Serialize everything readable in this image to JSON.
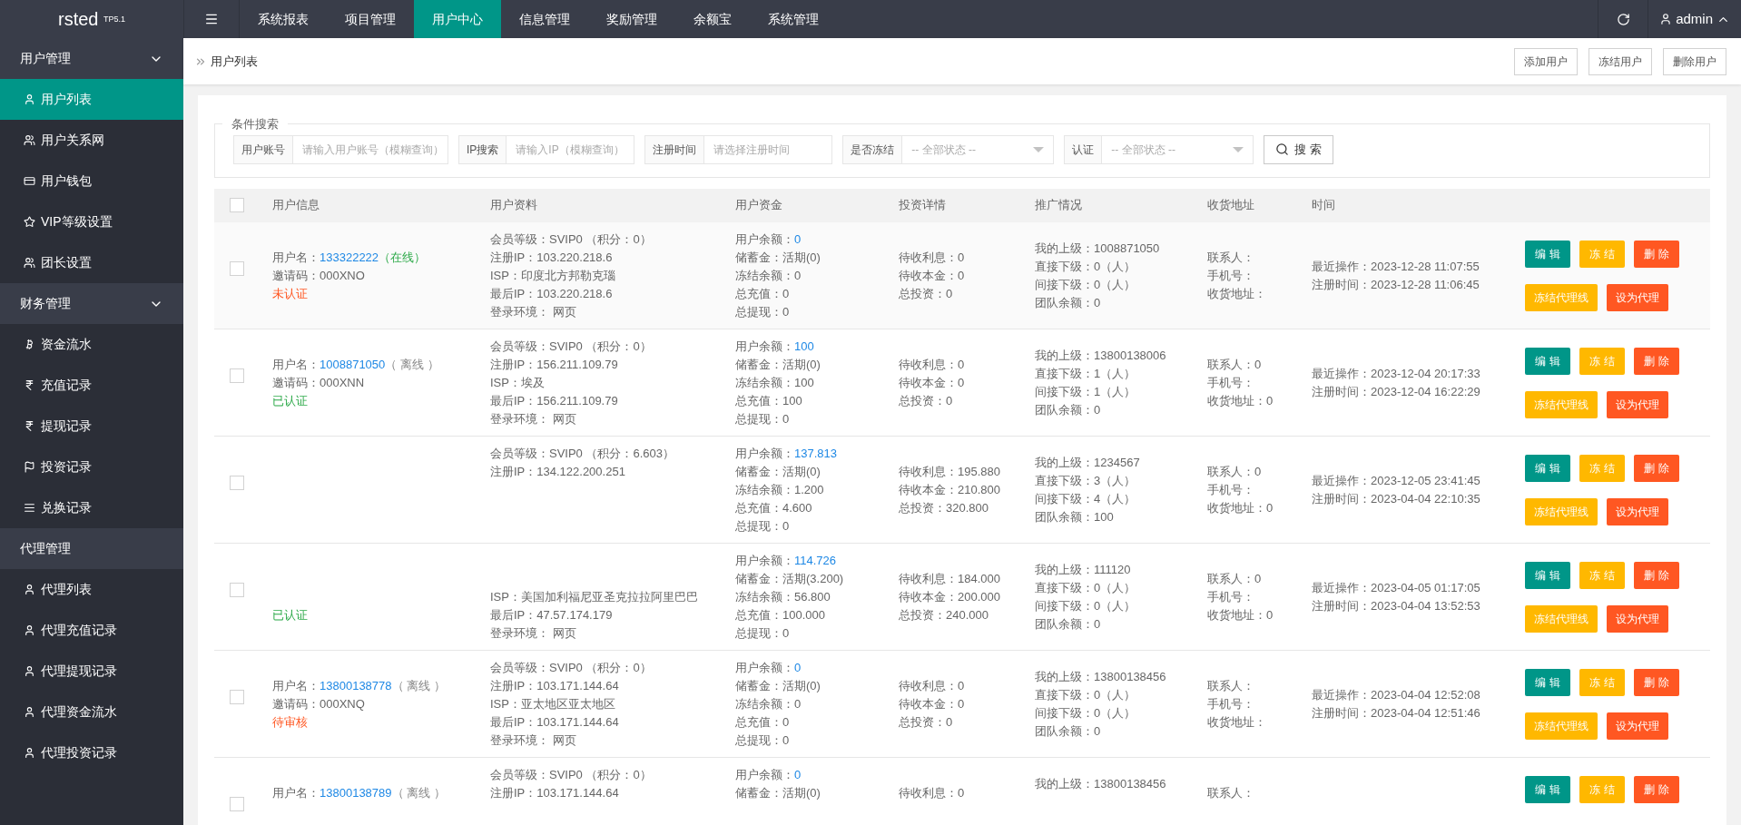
{
  "logo": "rsted $^{TP5.1}$",
  "nav": {
    "tabs": [
      {
        "label": "系统报表",
        "selected": false
      },
      {
        "label": "项目管理",
        "selected": false
      },
      {
        "label": "用户中心",
        "selected": true
      },
      {
        "label": "信息管理",
        "selected": false
      },
      {
        "label": "奖励管理",
        "selected": false
      },
      {
        "label": "余额宝",
        "selected": false
      },
      {
        "label": "系统管理",
        "selected": false
      }
    ],
    "user": "admin"
  },
  "sidebar": {
    "groups": [
      {
        "title": "用户管理",
        "expanded": true,
        "items": [
          {
            "label": "用户列表",
            "selected": true
          },
          {
            "label": "用户关系网",
            "selected": false
          },
          {
            "label": "用户钱包",
            "selected": false
          },
          {
            "label": "VIP等级设置",
            "selected": false
          },
          {
            "label": "团长设置",
            "selected": false
          }
        ]
      },
      {
        "title": "财务管理",
        "expanded": true,
        "items": [
          {
            "label": "资金流水",
            "selected": false
          },
          {
            "label": "充值记录",
            "selected": false
          },
          {
            "label": "提现记录",
            "selected": false
          },
          {
            "label": "投资记录",
            "selected": false
          },
          {
            "label": "兑换记录",
            "selected": false
          }
        ]
      },
      {
        "title": "代理管理",
        "items": [
          {
            "label": "代理列表",
            "selected": false
          },
          {
            "label": "代理充值记录",
            "selected": false
          },
          {
            "label": "代理提现记录",
            "selected": false
          },
          {
            "label": "代理资金流水",
            "selected": false
          },
          {
            "label": "代理投资记录",
            "selected": false
          }
        ]
      }
    ]
  },
  "breadcrumb": "用户列表",
  "toolbar_buttons": [
    "添加用户",
    "冻结用户",
    "删除用户"
  ],
  "search": {
    "legend": "条件搜索",
    "fields": [
      {
        "kind": "input",
        "label": "用户账号",
        "placeholder": "请输入用户账号（模糊查询）"
      },
      {
        "kind": "input",
        "label": "IP搜索",
        "placeholder": "请输入IP（模糊查询）"
      },
      {
        "kind": "input",
        "label": "注册时间",
        "placeholder": "请选择注册时间"
      },
      {
        "kind": "select",
        "label": "是否冻结",
        "value": "-- 全部状态 --"
      },
      {
        "kind": "select",
        "label": "认证",
        "value": "-- 全部状态 --"
      }
    ],
    "button": "搜 索"
  },
  "table": {
    "header_checked": false,
    "columns": [
      "用户信息",
      "用户资料",
      "用户资金",
      "投资详情",
      "推广情况",
      "收货地址",
      "时间"
    ],
    "rows": [
      {
        "checked": false,
        "name_label": "用户名：",
        "name": "133322222",
        "online": true,
        "status_text": "（在线）",
        "invite": "邀请码：000XNO",
        "auth": {
          "text": "未认证",
          "kind": "unverified"
        },
        "profile": [
          "会员等级：SVIP0 （积分：0）",
          "注册IP：103.220.218.6",
          "ISP：印度北方邦勒克瑙",
          "最后IP：103.220.218.6",
          "登录环境： 网页"
        ],
        "balance_label": "用户余额：",
        "balance": "0",
        "funds": [
          "储蓄金：活期(0)",
          "冻结余额：0",
          "总充值：0",
          "总提现：0"
        ],
        "invest": [
          "待收利息：0",
          "待收本金：0",
          "总投资：0"
        ],
        "promo": [
          "我的上级：1008871050",
          "直接下级：0（人）",
          "间接下级：0（人）",
          "团队余额：0"
        ],
        "address": [
          "联系人：",
          "手机号：",
          "收货地址："
        ],
        "time": [
          "最近操作：2023-12-28 11:07:55",
          "注册时间：2023-12-28 11:06:45"
        ],
        "actions": [
          {
            "label": "编 辑",
            "kind": "primary"
          },
          {
            "label": "冻 结",
            "kind": "warn"
          },
          {
            "label": "删 除",
            "kind": "danger"
          }
        ],
        "agent_actions": [
          {
            "label": "冻结代理线",
            "kind": "warn"
          },
          {
            "label": "设为代理",
            "kind": "danger"
          }
        ]
      },
      {
        "checked": false,
        "name_label": "用户名：",
        "name": "1008871050",
        "online": false,
        "status_text": "（ 离线 ）",
        "invite": "邀请码：000XNN",
        "auth": {
          "text": "已认证",
          "kind": "verified"
        },
        "profile": [
          "会员等级：SVIP0 （积分：0）",
          "注册IP：156.211.109.79",
          "ISP：埃及",
          "最后IP：156.211.109.79",
          "登录环境： 网页"
        ],
        "balance_label": "用户余额：",
        "balance": "100",
        "funds": [
          "储蓄金：活期(0)",
          "冻结余额：100",
          "总充值：100",
          "总提现：0"
        ],
        "invest": [
          "待收利息：0",
          "待收本金：0",
          "总投资：0"
        ],
        "promo": [
          "我的上级：13800138006",
          "直接下级：1（人）",
          "间接下级：1（人）",
          "团队余额：0"
        ],
        "address": [
          "联系人：0",
          "手机号：",
          "收货地址：0"
        ],
        "time": [
          "最近操作：2023-12-04 20:17:33",
          "注册时间：2023-12-04 16:22:29"
        ],
        "actions": [
          {
            "label": "编 辑",
            "kind": "primary"
          },
          {
            "label": "冻 结",
            "kind": "warn"
          },
          {
            "label": "删 除",
            "kind": "danger"
          }
        ],
        "agent_actions": [
          {
            "label": "冻结代理线",
            "kind": "warn"
          },
          {
            "label": "设为代理",
            "kind": "danger"
          }
        ]
      },
      {
        "checked": false,
        "profile": [
          "会员等级：SVIP0 （积分：6.603）",
          "注册IP：134.122.200.251"
        ],
        "balance_label": "用户余额：",
        "balance": "137.813",
        "funds": [
          "储蓄金：活期(0)",
          "冻结余额：1.200",
          "总充值：4.600",
          "总提现：0"
        ],
        "invest": [
          "待收利息：195.880",
          "待收本金：210.800",
          "总投资：320.800"
        ],
        "promo": [
          "我的上级：1234567",
          "直接下级：3（人）",
          "间接下级：4（人）",
          "团队余额：100"
        ],
        "address": [
          "联系人：0",
          "手机号：",
          "收货地址：0"
        ],
        "time": [
          "最近操作：2023-12-05 23:41:45",
          "注册时间：2023-04-04 22:10:35"
        ],
        "actions": [
          {
            "label": "编 辑",
            "kind": "primary"
          },
          {
            "label": "冻 结",
            "kind": "warn"
          },
          {
            "label": "删 除",
            "kind": "danger"
          }
        ],
        "agent_actions": [
          {
            "label": "冻结代理线",
            "kind": "warn"
          },
          {
            "label": "设为代理",
            "kind": "danger"
          }
        ]
      },
      {
        "checked": false,
        "auth": {
          "text": "已认证",
          "kind": "verified"
        },
        "profile_lower": [
          "ISP：美国加利福尼亚圣克拉拉阿里巴巴",
          "最后IP：47.57.174.179",
          "登录环境： 网页"
        ],
        "balance_label": "用户余额：",
        "balance": "114.726",
        "funds": [
          "储蓄金：活期(3.200)",
          "冻结余额：56.800",
          "总充值：100.000",
          "总提现：0"
        ],
        "invest": [
          "待收利息：184.000",
          "待收本金：200.000",
          "总投资：240.000"
        ],
        "promo": [
          "我的上级：111120",
          "直接下级：0（人）",
          "间接下级：0（人）",
          "团队余额：0"
        ],
        "address": [
          "联系人：0",
          "手机号：",
          "收货地址：0"
        ],
        "time": [
          "最近操作：2023-04-05 01:17:05",
          "注册时间：2023-04-04 13:52:53"
        ],
        "actions": [
          {
            "label": "编 辑",
            "kind": "primary"
          },
          {
            "label": "冻 结",
            "kind": "warn"
          },
          {
            "label": "删 除",
            "kind": "danger"
          }
        ],
        "agent_actions": [
          {
            "label": "冻结代理线",
            "kind": "warn"
          },
          {
            "label": "设为代理",
            "kind": "danger"
          }
        ]
      },
      {
        "checked": false,
        "name_label": "用户名：",
        "name": "13800138778",
        "online": false,
        "status_text": "（ 离线 ）",
        "invite": "邀请码：000XNQ",
        "auth": {
          "text": "待审核",
          "kind": "pending"
        },
        "profile": [
          "会员等级：SVIP0 （积分：0）",
          "注册IP：103.171.144.64",
          "ISP：亚太地区亚太地区",
          "最后IP：103.171.144.64",
          "登录环境： 网页"
        ],
        "balance_label": "用户余额：",
        "balance": "0",
        "funds": [
          "储蓄金：活期(0)",
          "冻结余额：0",
          "总充值：0",
          "总提现：0"
        ],
        "invest": [
          "待收利息：0",
          "待收本金：0",
          "总投资：0"
        ],
        "promo": [
          "我的上级：13800138456",
          "直接下级：0（人）",
          "间接下级：0（人）",
          "团队余额：0"
        ],
        "address": [
          "联系人：",
          "手机号：",
          "收货地址："
        ],
        "time": [
          "最近操作：2023-04-04 12:52:08",
          "注册时间：2023-04-04 12:51:46"
        ],
        "actions": [
          {
            "label": "编 辑",
            "kind": "primary"
          },
          {
            "label": "冻 结",
            "kind": "warn"
          },
          {
            "label": "删 除",
            "kind": "danger"
          }
        ],
        "agent_actions": [
          {
            "label": "冻结代理线",
            "kind": "warn"
          },
          {
            "label": "设为代理",
            "kind": "danger"
          }
        ]
      },
      {
        "checked": false,
        "name_label": "用户名：",
        "name": "13800138789",
        "online": false,
        "status_text": "（ 离线 ）",
        "profile": [
          "会员等级：SVIP0 （积分：0）",
          "注册IP：103.171.144.64"
        ],
        "balance_label": "用户余额：",
        "balance": "0",
        "funds": [
          "储蓄金：活期(0)"
        ],
        "invest": [
          "待收利息：0"
        ],
        "promo": [
          "我的上级：13800138456"
        ],
        "address": [
          "联系人："
        ],
        "actions": [
          {
            "label": "编 辑",
            "kind": "primary"
          },
          {
            "label": "冻 结",
            "kind": "warn"
          },
          {
            "label": "删 除",
            "kind": "danger"
          }
        ]
      }
    ]
  }
}
